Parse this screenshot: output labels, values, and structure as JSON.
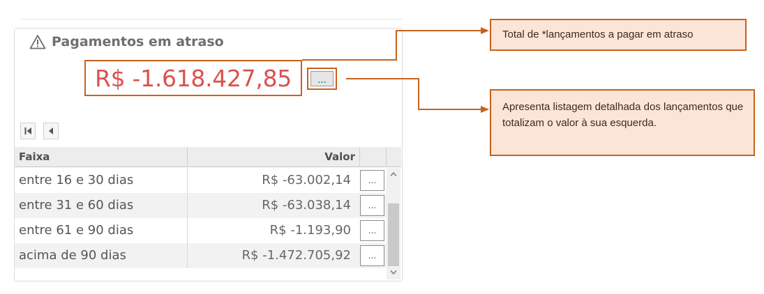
{
  "widget": {
    "title": "Pagamentos em atraso",
    "kpi_value": "R$ -1.618.427,85",
    "kpi_button_label": "...",
    "table": {
      "columns": [
        "Faixa",
        "Valor"
      ],
      "rows": [
        {
          "faixa": "entre 16 e 30 dias",
          "valor": "R$ -63.002,14",
          "button": "..."
        },
        {
          "faixa": "entre 31 e 60 dias",
          "valor": "R$ -63.038,14",
          "button": "..."
        },
        {
          "faixa": "entre 61 e 90 dias",
          "valor": "R$ -1.193,90",
          "button": "..."
        },
        {
          "faixa": "acima de 90 dias",
          "valor": "R$ -1.472.705,92",
          "button": "..."
        }
      ]
    }
  },
  "annotations": {
    "callout_total": "Total de *lançamentos a pagar em atraso",
    "callout_detail": "Apresenta listagem detalhada dos lançamentos que totalizam o valor à sua esquerda."
  },
  "colors": {
    "kpi_text": "#d9534f",
    "highlight_border": "#c5621c",
    "callout_fill": "#fbe5d6"
  }
}
